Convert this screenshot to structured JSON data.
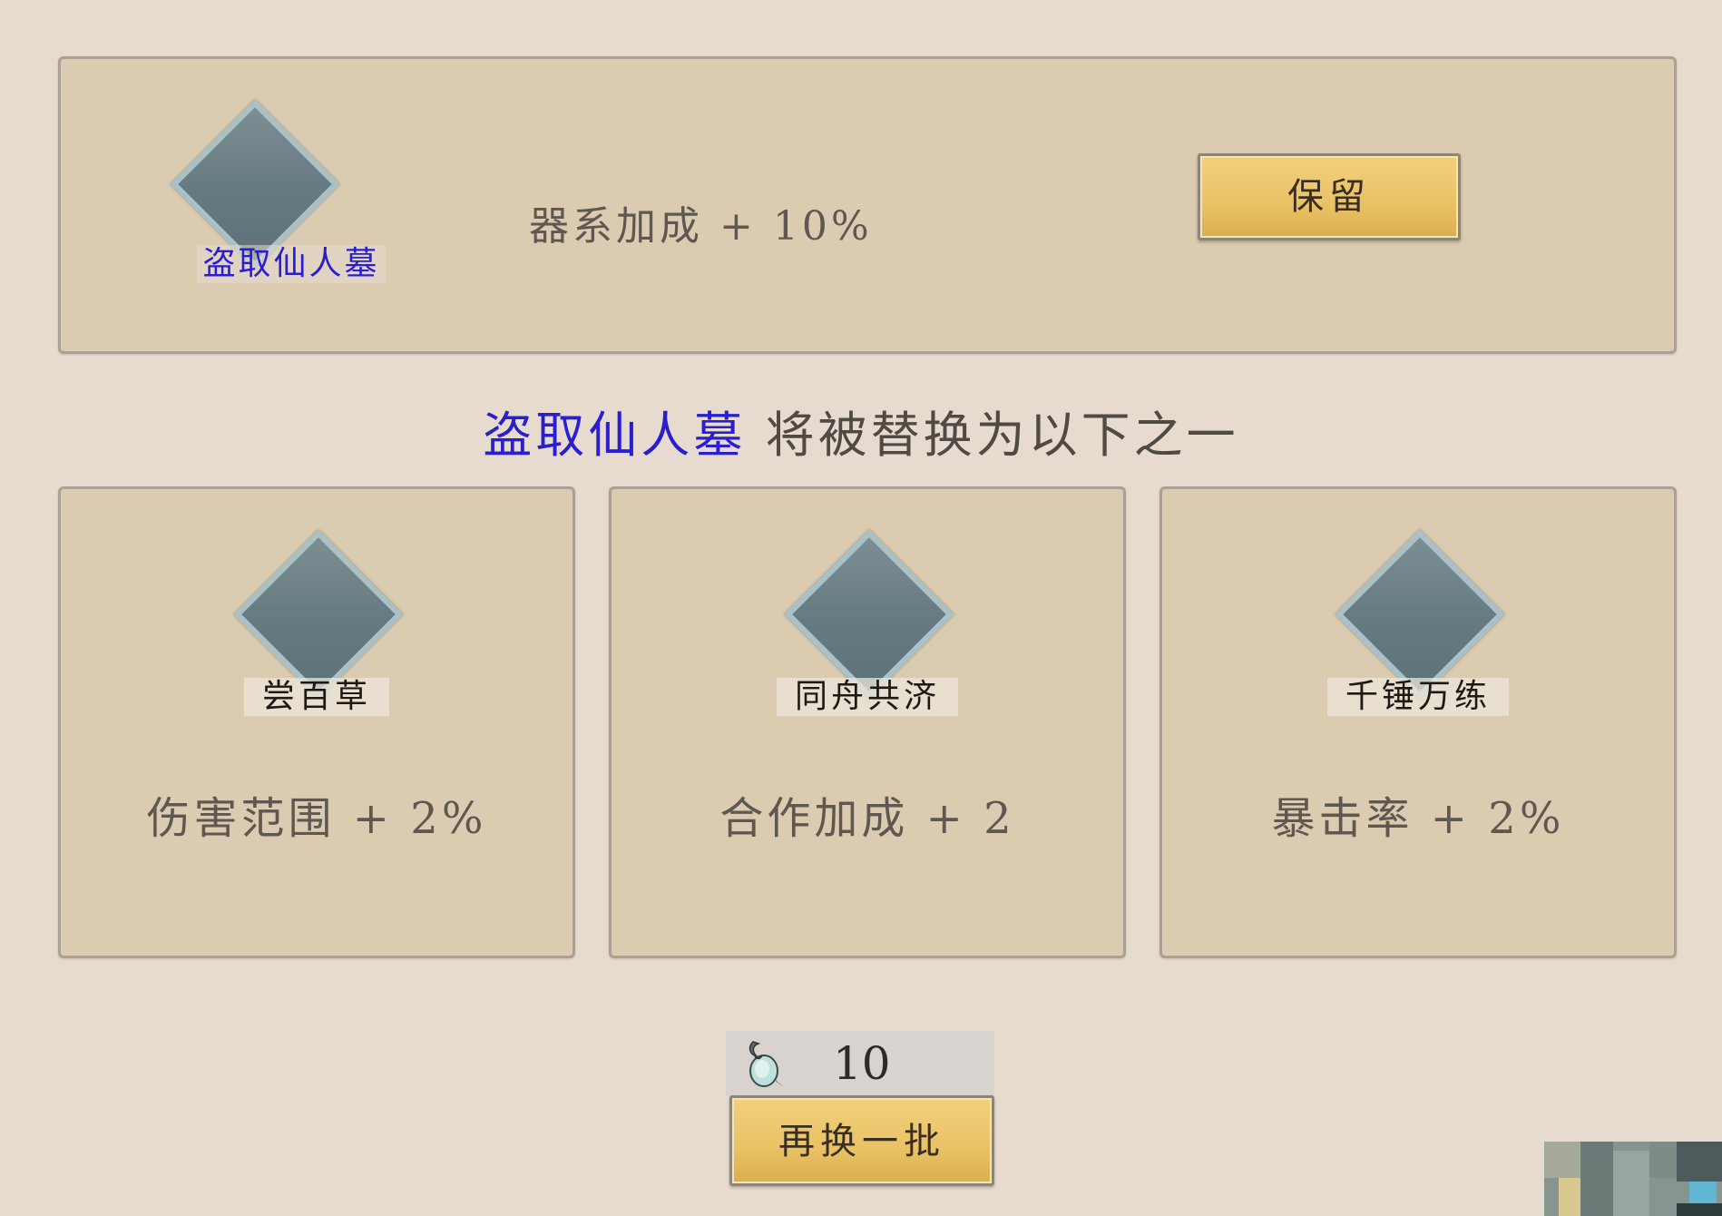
{
  "current_skill": {
    "name": "盗取仙人墓",
    "effect": "器系加成 + 10%",
    "icon": "diamond-gem-icon",
    "name_color": "#2a1fd0"
  },
  "keep_button": {
    "label": "保留"
  },
  "prompt": {
    "highlight": "盗取仙人墓",
    "text": "将被替换为以下之一"
  },
  "options": [
    {
      "name": "尝百草",
      "effect": "伤害范围 + 2%",
      "icon": "diamond-gem-icon"
    },
    {
      "name": "同舟共济",
      "effect": "合作加成 + 2",
      "icon": "diamond-gem-icon"
    },
    {
      "name": "千锤万练",
      "effect": "暴击率 + 2%",
      "icon": "diamond-gem-icon"
    }
  ],
  "cost": {
    "icon": "jade-pendant-icon",
    "value": "10"
  },
  "refresh_button": {
    "label": "再换一批"
  },
  "colors": {
    "background": "#e7dbcf",
    "panel": "#dbcbb0",
    "button": "#e9c264",
    "highlight_text": "#2a1fd0"
  }
}
